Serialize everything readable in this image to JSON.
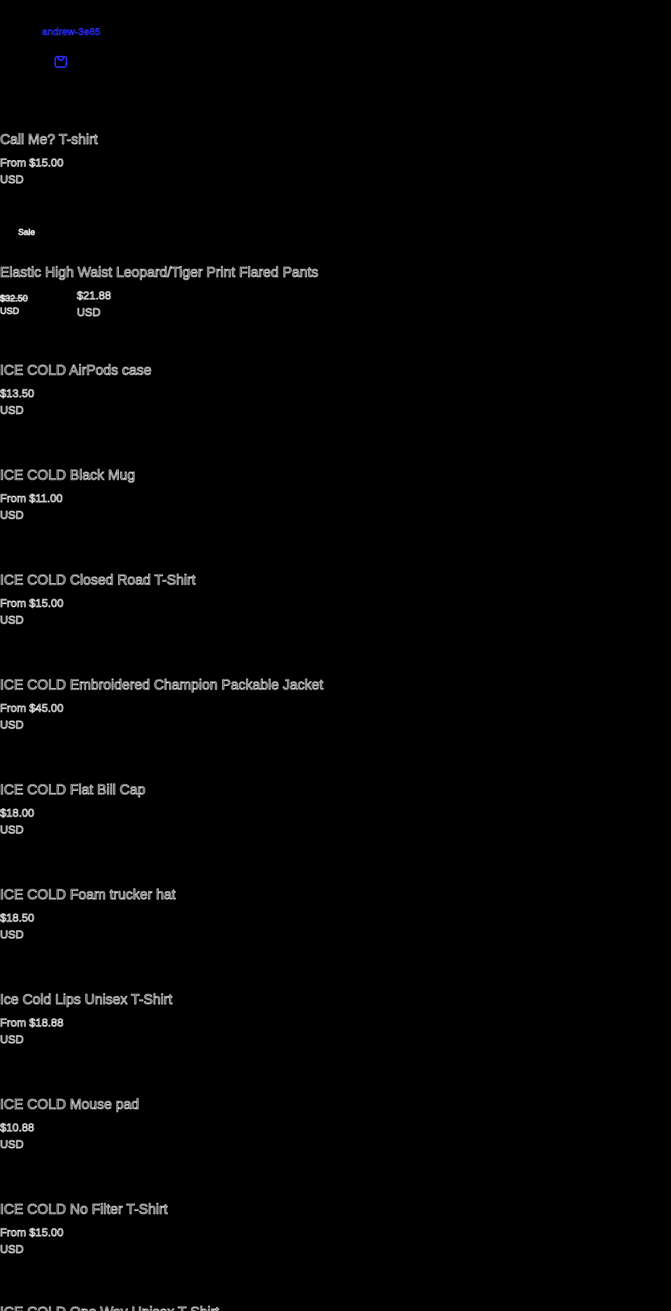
{
  "header": {
    "store_name": "andrew-3e85",
    "cart_icon": "shopping-bag-icon",
    "accent_color": "#2a2aff"
  },
  "products": [
    {
      "title": "Call Me? T-shirt",
      "price": "From $15.00",
      "currency": "USD"
    },
    {
      "badge": "Sale",
      "title": "Elastic High Waist Leopard/Tiger Print Flared Pants",
      "regular_price": "$32.50",
      "regular_currency": "USD",
      "sale_price": "$21.88",
      "sale_currency": "USD"
    },
    {
      "title": "ICE COLD AirPods case",
      "price": "$13.50",
      "currency": "USD"
    },
    {
      "title": "ICE COLD Black Mug",
      "price": "From $11.00",
      "currency": "USD"
    },
    {
      "title": "ICE COLD Closed Road T-Shirt",
      "price": "From $15.00",
      "currency": "USD"
    },
    {
      "title": "ICE COLD Embroidered Champion Packable Jacket",
      "price": "From $45.00",
      "currency": "USD"
    },
    {
      "title": "ICE COLD Flat Bill Cap",
      "price": "$18.00",
      "currency": "USD"
    },
    {
      "title": "ICE COLD Foam trucker hat",
      "price": "$18.50",
      "currency": "USD"
    },
    {
      "title": "Ice Cold Lips Unisex T-Shirt",
      "price": "From $18.88",
      "currency": "USD"
    },
    {
      "title": "ICE COLD Mouse pad",
      "price": "$10.88",
      "currency": "USD"
    },
    {
      "title": "ICE COLD No Filter T-Shirt",
      "price": "From $15.00",
      "currency": "USD"
    },
    {
      "title": "ICE COLD One Way Unisex T-Shirt"
    }
  ]
}
